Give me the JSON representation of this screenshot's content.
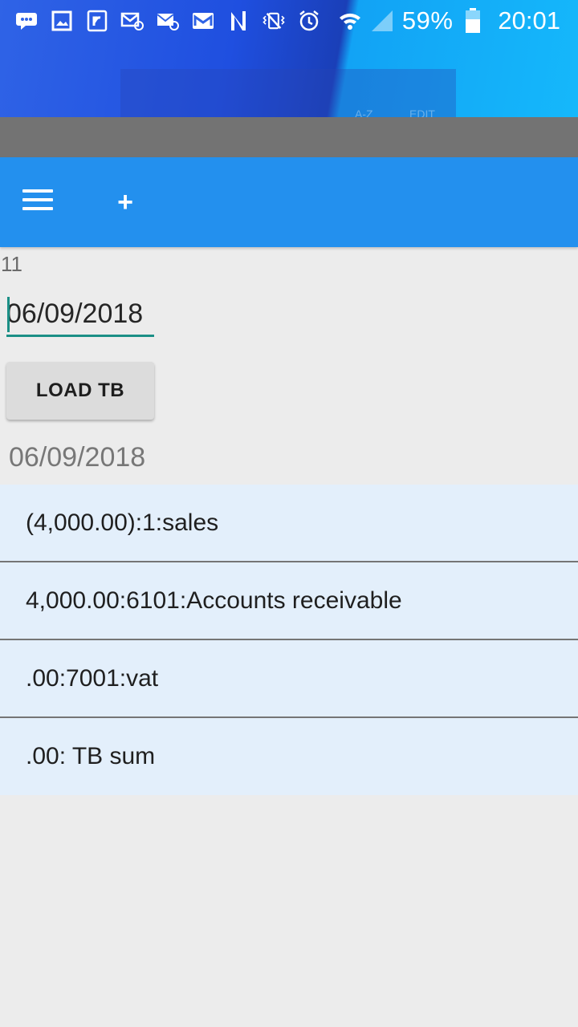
{
  "status_bar": {
    "icons": [
      "chat-bubble-icon",
      "image-icon",
      "reddit-icon",
      "email-at-icon",
      "email-at-icon",
      "gmail-icon",
      "nfc-icon",
      "vibrate-mute-icon",
      "alarm-icon",
      "wifi-icon",
      "signal-icon",
      "battery-icon"
    ],
    "battery_percent": "59%",
    "time": "20:01"
  },
  "background_ghost": {
    "a": "A-Z",
    "b": "EDIT"
  },
  "toolbar": {
    "menu_icon": "hamburger-menu-icon",
    "add_icon": "plus-icon",
    "add_symbol": "+",
    "color": "#2390ee"
  },
  "content": {
    "count": "11",
    "date_input_value": "06/09/2018",
    "load_button_label": "LOAD TB",
    "date_label": "06/09/2018",
    "items": [
      "(4,000.00):1:sales",
      "4,000.00:6101:Accounts receivable",
      ".00:7001:vat",
      ".00: TB sum"
    ]
  },
  "colors": {
    "accent": "#1b8f86",
    "list_bg": "#e3effb",
    "background": "#ececec"
  }
}
